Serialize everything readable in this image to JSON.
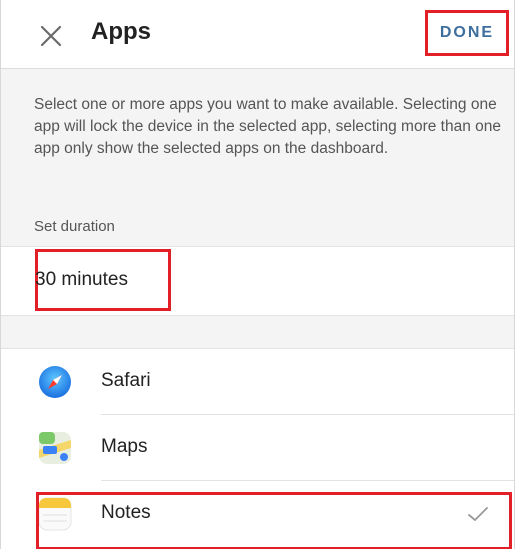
{
  "header": {
    "title": "Apps",
    "done_label": "DONE",
    "close_icon": "close-icon"
  },
  "description": "Select one or more apps you want to make available. Selecting one app will lock the device in the selected app, selecting more than one app only show the selected apps on the dashboard.",
  "duration": {
    "label": "Set duration",
    "value": "30 minutes"
  },
  "apps": [
    {
      "name": "Safari",
      "icon": "safari-icon",
      "selected": false
    },
    {
      "name": "Maps",
      "icon": "maps-icon",
      "selected": false
    },
    {
      "name": "Notes",
      "icon": "notes-icon",
      "selected": true
    }
  ],
  "colors": {
    "accent_blue": "#3d6e9e",
    "highlight_red": "#e21f26"
  }
}
